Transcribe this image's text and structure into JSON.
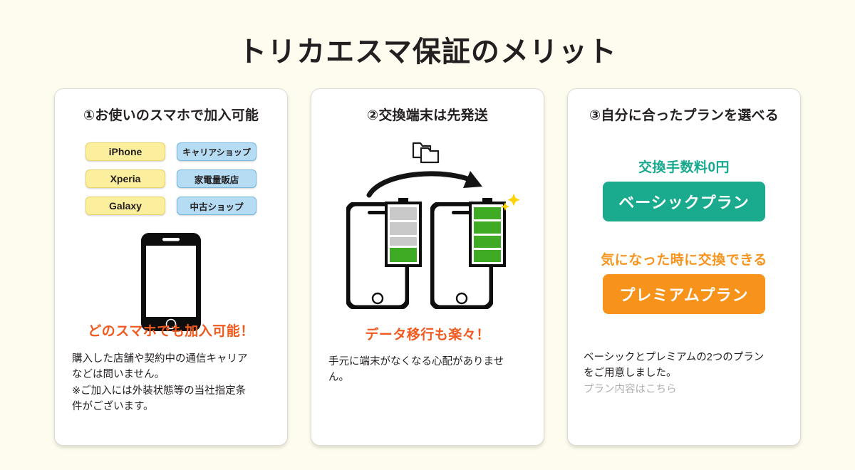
{
  "page": {
    "title": "トリカエスマ保証のメリット",
    "background_color": "#fdfcee"
  },
  "colors": {
    "accent_orange": "#f15a1e",
    "teal": "#1aab8f",
    "orange": "#f7931a",
    "tag_yellow": "#fbee9c",
    "tag_blue": "#b5dcf3",
    "battery_green": "#3faa23",
    "battery_gray": "#c8c8c8",
    "sparkle_yellow": "#ffd200",
    "link_gray": "#b0b0b0"
  },
  "cards": [
    {
      "heading": "①お使いのスマホで加入可能",
      "device_tags": [
        "iPhone",
        "Xperia",
        "Galaxy"
      ],
      "shop_tags": [
        "キャリアショップ",
        "家電量販店",
        "中古ショップ"
      ],
      "illustration": "smartphone-outline",
      "highlight": "どのスマホでも加入可能！",
      "body_lines": [
        "購入した店舗や契約中の通信キャリア",
        "などは問いません。",
        "※ご加入には外装状態等の当社指定条",
        "件がございます。"
      ]
    },
    {
      "heading": "②交換端末は先発送",
      "illustration": "folders-arrow-two-phones-battery",
      "highlight": "データ移行も楽々！",
      "body_lines": [
        "手元に端末がなくなる心配がありませ",
        "ん。"
      ]
    },
    {
      "heading": "③自分に合ったプランを選べる",
      "plans": [
        {
          "label": "交換手数料0円",
          "button": "ベーシックプラン",
          "color": "#1aab8f"
        },
        {
          "label": "気になった時に交換できる",
          "button": "プレミアムプラン",
          "color": "#f7931a"
        }
      ],
      "body_lines": [
        "ベーシックとプレミアムの2つのプラン",
        "をご用意しました。"
      ],
      "link": "プラン内容はこちら"
    }
  ]
}
